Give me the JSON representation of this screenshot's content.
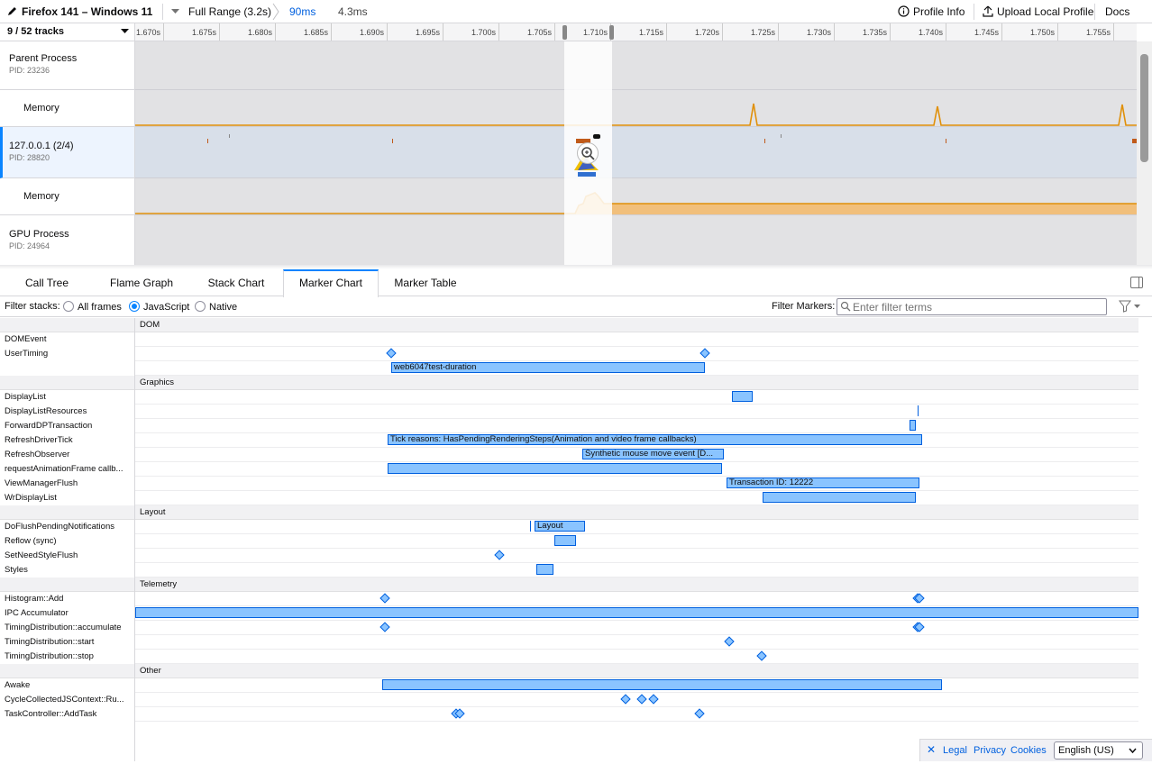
{
  "topbar": {
    "profile_name": "Firefox 141 – Windows 11",
    "breadcrumbs": [
      "Full Range (3.2s)",
      "90ms",
      "4.3ms"
    ],
    "profile_info": "Profile Info",
    "upload": "Upload Local Profile",
    "docs": "Docs"
  },
  "tracks": {
    "count_label": "9 / 52 tracks",
    "items": [
      {
        "title": "Parent Process",
        "pid": "PID: 23236"
      },
      {
        "title": "Memory"
      },
      {
        "title": "127.0.0.1 (2/4)",
        "pid": "PID: 28820"
      },
      {
        "title": "Memory"
      },
      {
        "title": "GPU Process",
        "pid": "PID: 24964"
      }
    ]
  },
  "ruler": {
    "ticks": [
      "1.670s",
      "1.675s",
      "1.680s",
      "1.685s",
      "1.690s",
      "1.695s",
      "1.700s",
      "1.705s",
      "1.710s",
      "1.715s",
      "1.720s",
      "1.725s",
      "1.730s",
      "1.735s",
      "1.740s",
      "1.745s",
      "1.750s",
      "1.755s"
    ]
  },
  "tabs": [
    "Call Tree",
    "Flame Graph",
    "Stack Chart",
    "Marker Chart",
    "Marker Table"
  ],
  "filter": {
    "stacks_label": "Filter stacks:",
    "options": [
      "All frames",
      "JavaScript",
      "Native"
    ],
    "selected": "JavaScript",
    "markers_label": "Filter Markers:",
    "placeholder": "Enter filter terms"
  },
  "markers": {
    "groups": {
      "dom": "DOM",
      "graphics": "Graphics",
      "layout": "Layout",
      "telemetry": "Telemetry",
      "other": "Other"
    },
    "rows": {
      "domevent": "DOMEvent",
      "usertiming": "UserTiming",
      "displaylist": "DisplayList",
      "displaylistresources": "DisplayListResources",
      "forwarddp": "ForwardDPTransaction",
      "refreshdrivertick": "RefreshDriverTick",
      "refreshobserver": "RefreshObserver",
      "raf": "requestAnimationFrame callb...",
      "viewmanagerflush": "ViewManagerFlush",
      "wrdisplaylist": "WrDisplayList",
      "doflush": "DoFlushPendingNotifications",
      "reflow": "Reflow (sync)",
      "setneedstyleflush": "SetNeedStyleFlush",
      "styles": "Styles",
      "histogramadd": "Histogram::Add",
      "ipcaccumulator": "IPC Accumulator",
      "tdaccumulate": "TimingDistribution::accumulate",
      "tdstart": "TimingDistribution::start",
      "tdstop": "TimingDistribution::stop",
      "awake": "Awake",
      "ccjs": "CycleCollectedJSContext::Ru...",
      "taskcontroller": "TaskController::AddTask"
    },
    "bar_labels": {
      "web6047": "web6047test-duration",
      "tick": "Tick reasons: HasPendingRenderingSteps(Animation and video frame callbacks)",
      "mouse": "Synthetic mouse move event [D...",
      "transaction": "Transaction ID: 12222",
      "layout": "Layout"
    }
  },
  "footer": {
    "legal": "Legal",
    "privacy": "Privacy",
    "cookies": "Cookies",
    "language": "English (US)"
  },
  "colors": {
    "accent": "#0a84ff",
    "marker_fill": "#8ac4ff",
    "marker_border": "#0060df",
    "memory_orange": "#e0900a"
  }
}
